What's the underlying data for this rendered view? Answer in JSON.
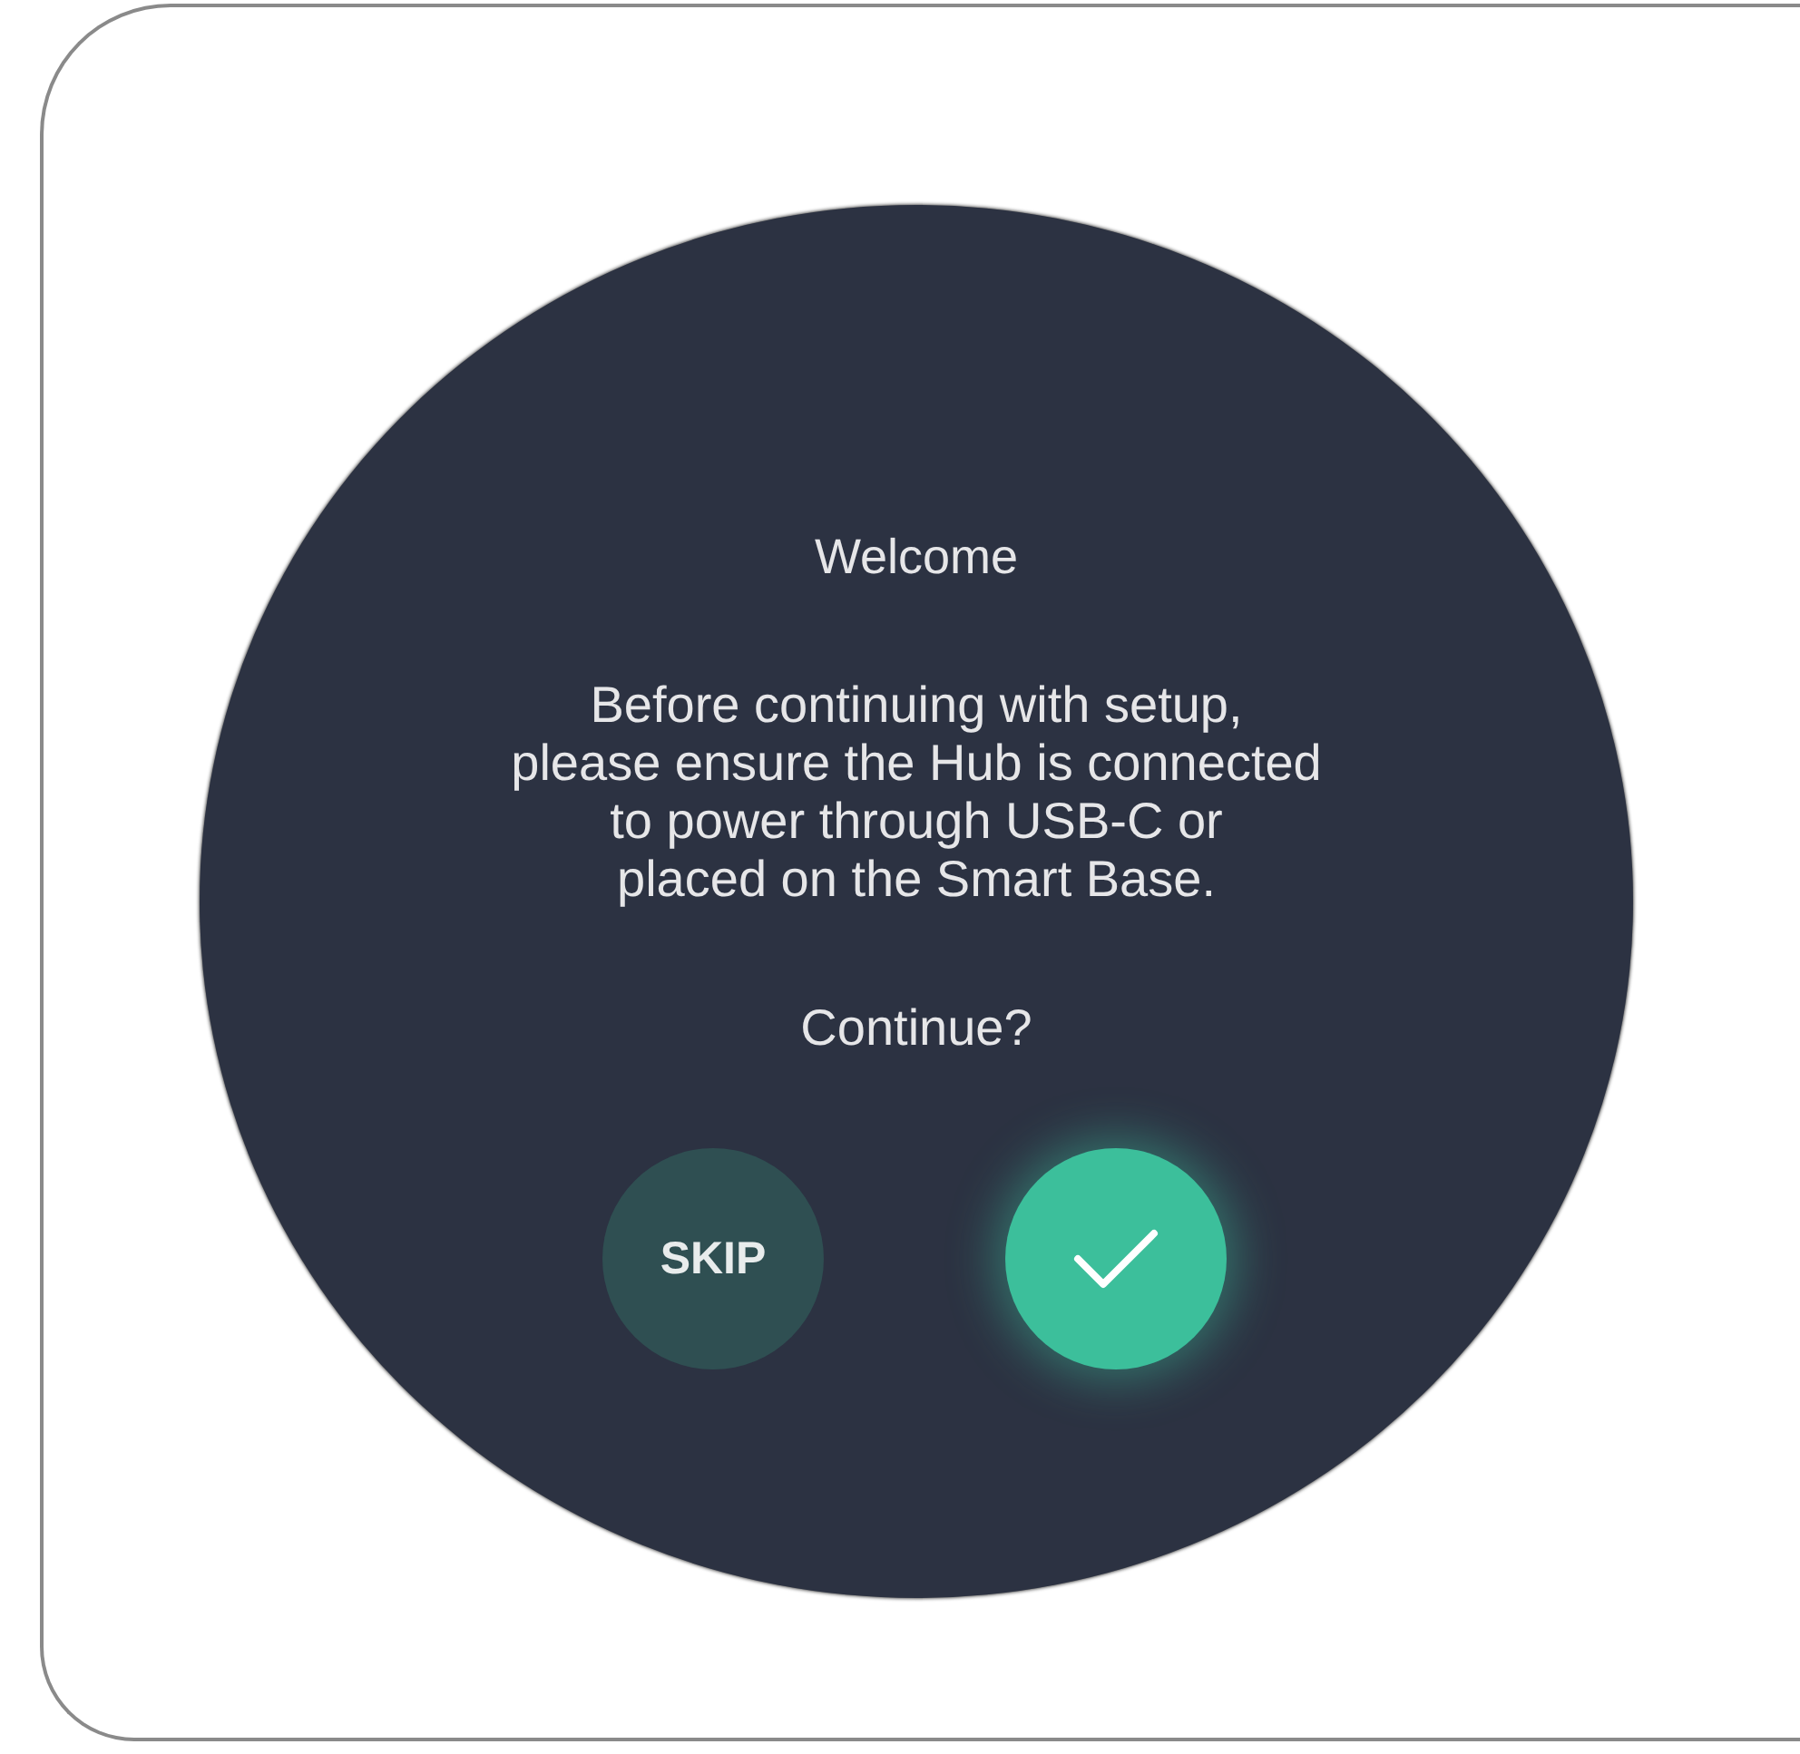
{
  "screen": {
    "title": "Welcome",
    "message": "Before continuing with setup,\nplease ensure the Hub is connected\nto power through USB-C or\nplaced on the Smart Base.",
    "question": "Continue?"
  },
  "buttons": [
    {
      "kind": "skip",
      "label": "SKIP"
    },
    {
      "kind": "confirm"
    }
  ]
}
